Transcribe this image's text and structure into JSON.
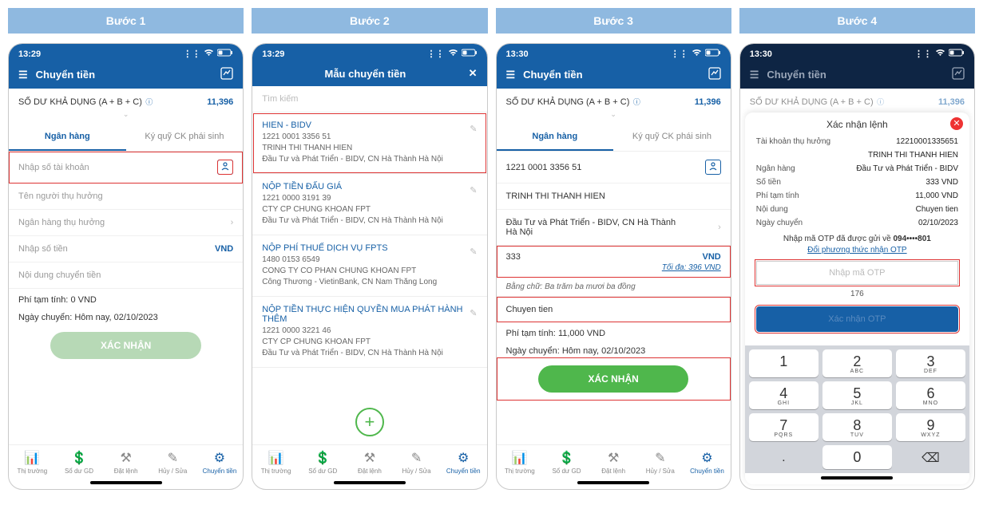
{
  "steps": [
    "Bước 1",
    "Bước 2",
    "Bước 3",
    "Bước 4"
  ],
  "phone1": {
    "time": "13:29",
    "title": "Chuyển tiền",
    "balance_label": "SỐ DƯ KHẢ DỤNG (A + B + C)",
    "balance": "11,396",
    "tab_bank": "Ngân hàng",
    "tab_margin": "Ký quỹ CK phái sinh",
    "ph_account": "Nhập số tài khoản",
    "ph_beneficiary": "Tên người thụ hưởng",
    "ph_bank": "Ngân hàng thụ hưởng",
    "ph_amount": "Nhập số tiền",
    "ph_content": "Nội dung chuyển tiền",
    "currency": "VND",
    "fee_label": "Phí tạm tính:",
    "fee_value": "0 VND",
    "date_label": "Ngày chuyển:",
    "date_value": "Hôm nay,  02/10/2023",
    "submit": "XÁC NHẬN"
  },
  "phone2": {
    "time": "13:29",
    "title": "Mẫu chuyển tiền",
    "search_ph": "Tìm kiếm",
    "templates": [
      {
        "title": "HIEN - BIDV",
        "acct": "1221 0001 3356 51",
        "name": "TRINH THI THANH HIEN",
        "bank": "Đầu Tư và Phát Triển - BIDV, CN Hà Thành Hà Nội"
      },
      {
        "title": "NỘP TIỀN ĐẤU GIÁ",
        "acct": "1221 0000 3191 39",
        "name": "CTY CP CHUNG KHOAN FPT",
        "bank": "Đầu Tư và Phát Triển - BIDV, CN Hà Thành Hà Nội"
      },
      {
        "title": "NỘP PHÍ THUẾ DỊCH VỤ FPTS",
        "acct": "1480 0153 6549",
        "name": "CONG TY CO PHAN CHUNG KHOAN FPT",
        "bank": "Công Thương - VietinBank, CN Nam Thăng Long"
      },
      {
        "title": "NỘP TIỀN THỰC HIỆN QUYỀN MUA PHÁT HÀNH THÊM",
        "acct": "1221 0000 3221 46",
        "name": "CTY CP CHUNG KHOAN FPT",
        "bank": "Đầu Tư và Phát Triển - BIDV, CN Hà Thành Hà Nội"
      }
    ]
  },
  "phone3": {
    "time": "13:30",
    "title": "Chuyển tiền",
    "balance_label": "SỐ DƯ KHẢ DỤNG (A + B + C)",
    "balance": "11,396",
    "tab_bank": "Ngân hàng",
    "tab_margin": "Ký quỹ CK phái sinh",
    "account": "1221 0001 3356 51",
    "name": "TRINH THI THANH HIEN",
    "bank": "Đầu Tư và Phát Triển - BIDV, CN Hà Thành Hà Nội",
    "amount": "333",
    "currency": "VND",
    "max_label": "Tối đa: 396 VND",
    "inwords_label": "Bằng chữ:",
    "inwords": "Ba trăm ba mươi ba đồng",
    "content": "Chuyen tien",
    "fee_label": "Phí tạm tính:",
    "fee_value": "11,000 VND",
    "date_label": "Ngày chuyển:",
    "date_value": "Hôm nay,  02/10/2023",
    "submit": "XÁC NHẬN"
  },
  "phone4": {
    "time": "13:30",
    "title": "Chuyển tiền",
    "balance_label": "SỐ DƯ KHẢ DỤNG (A + B + C)",
    "balance": "11,396",
    "ov_title": "Xác nhận lệnh",
    "rows": {
      "account_k": "Tài khoản thụ hưởng",
      "account_v": "12210001335651",
      "name_v": "TRINH THI THANH HIEN",
      "bank_k": "Ngân hàng",
      "bank_v": "Đầu Tư và Phát Triển - BIDV",
      "amount_k": "Số tiền",
      "amount_v": "333 VND",
      "fee_k": "Phí tạm tính",
      "fee_v": "11,000 VND",
      "content_k": "Nội dung",
      "content_v": "Chuyen tien",
      "date_k": "Ngày chuyển",
      "date_v": "02/10/2023"
    },
    "otp_msg_pre": "Nhập mã OTP đã được gửi về ",
    "otp_phone": "094••••801",
    "otp_link": "Đổi phương thức nhận OTP",
    "otp_ph": "Nhập mã OTP",
    "timer": "176",
    "otp_btn": "Xác nhận OTP",
    "keypad": [
      {
        "n": "1",
        "l": ""
      },
      {
        "n": "2",
        "l": "ABC"
      },
      {
        "n": "3",
        "l": "DEF"
      },
      {
        "n": "4",
        "l": "GHI"
      },
      {
        "n": "5",
        "l": "JKL"
      },
      {
        "n": "6",
        "l": "MNO"
      },
      {
        "n": "7",
        "l": "PQRS"
      },
      {
        "n": "8",
        "l": "TUV"
      },
      {
        "n": "9",
        "l": "WXYZ"
      },
      {
        "n": ".",
        "l": ""
      },
      {
        "n": "0",
        "l": ""
      },
      {
        "n": "⌫",
        "l": ""
      }
    ]
  },
  "nav": {
    "items": [
      "Thị trường",
      "Sổ dư GD",
      "Đặt lệnh",
      "Hủy / Sửa",
      "Chuyển tiền"
    ]
  }
}
